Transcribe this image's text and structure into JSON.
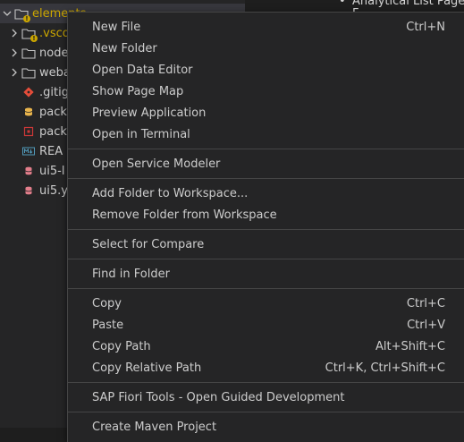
{
  "explorer": {
    "root_label": "elements",
    "items": [
      {
        "label": ".vsco",
        "icon": "folder-icon",
        "chevron": "chevron-right-icon",
        "warn": true
      },
      {
        "label": "node",
        "icon": "folder-icon",
        "chevron": "chevron-right-icon"
      },
      {
        "label": "weba",
        "icon": "folder-icon",
        "chevron": "chevron-right-icon"
      },
      {
        "label": ".gitig",
        "icon": "git-icon"
      },
      {
        "label": "pack",
        "icon": "package-json-icon"
      },
      {
        "label": "pack",
        "icon": "package-lock-icon"
      },
      {
        "label": "REA",
        "icon": "markdown-icon"
      },
      {
        "label": "ui5-l",
        "icon": "yaml-icon"
      },
      {
        "label": "ui5.y",
        "icon": "yaml-icon"
      }
    ]
  },
  "editor_peek": {
    "bullet": "•",
    "line1": "Analytical List Page w",
    "line2": "F"
  },
  "context_menu": {
    "groups": [
      [
        {
          "label": "New File",
          "shortcut": "Ctrl+N"
        },
        {
          "label": "New Folder",
          "shortcut": ""
        },
        {
          "label": "Open Data Editor",
          "shortcut": ""
        },
        {
          "label": "Show Page Map",
          "shortcut": ""
        },
        {
          "label": "Preview Application",
          "shortcut": ""
        },
        {
          "label": "Open in Terminal",
          "shortcut": ""
        }
      ],
      [
        {
          "label": "Open Service Modeler",
          "shortcut": ""
        }
      ],
      [
        {
          "label": "Add Folder to Workspace...",
          "shortcut": ""
        },
        {
          "label": "Remove Folder from Workspace",
          "shortcut": ""
        }
      ],
      [
        {
          "label": "Select for Compare",
          "shortcut": ""
        }
      ],
      [
        {
          "label": "Find in Folder",
          "shortcut": ""
        }
      ],
      [
        {
          "label": "Copy",
          "shortcut": "Ctrl+C"
        },
        {
          "label": "Paste",
          "shortcut": "Ctrl+V"
        },
        {
          "label": "Copy Path",
          "shortcut": "Alt+Shift+C"
        },
        {
          "label": "Copy Relative Path",
          "shortcut": "Ctrl+K, Ctrl+Shift+C"
        }
      ],
      [
        {
          "label": "SAP Fiori Tools - Open Guided Development",
          "shortcut": ""
        }
      ],
      [
        {
          "label": "Create Maven Project",
          "shortcut": ""
        }
      ]
    ]
  },
  "colors": {
    "background": "#1e1e1e",
    "sidebar": "#252526",
    "menu": "#252526",
    "separator": "#454545",
    "warning": "#cca700"
  }
}
